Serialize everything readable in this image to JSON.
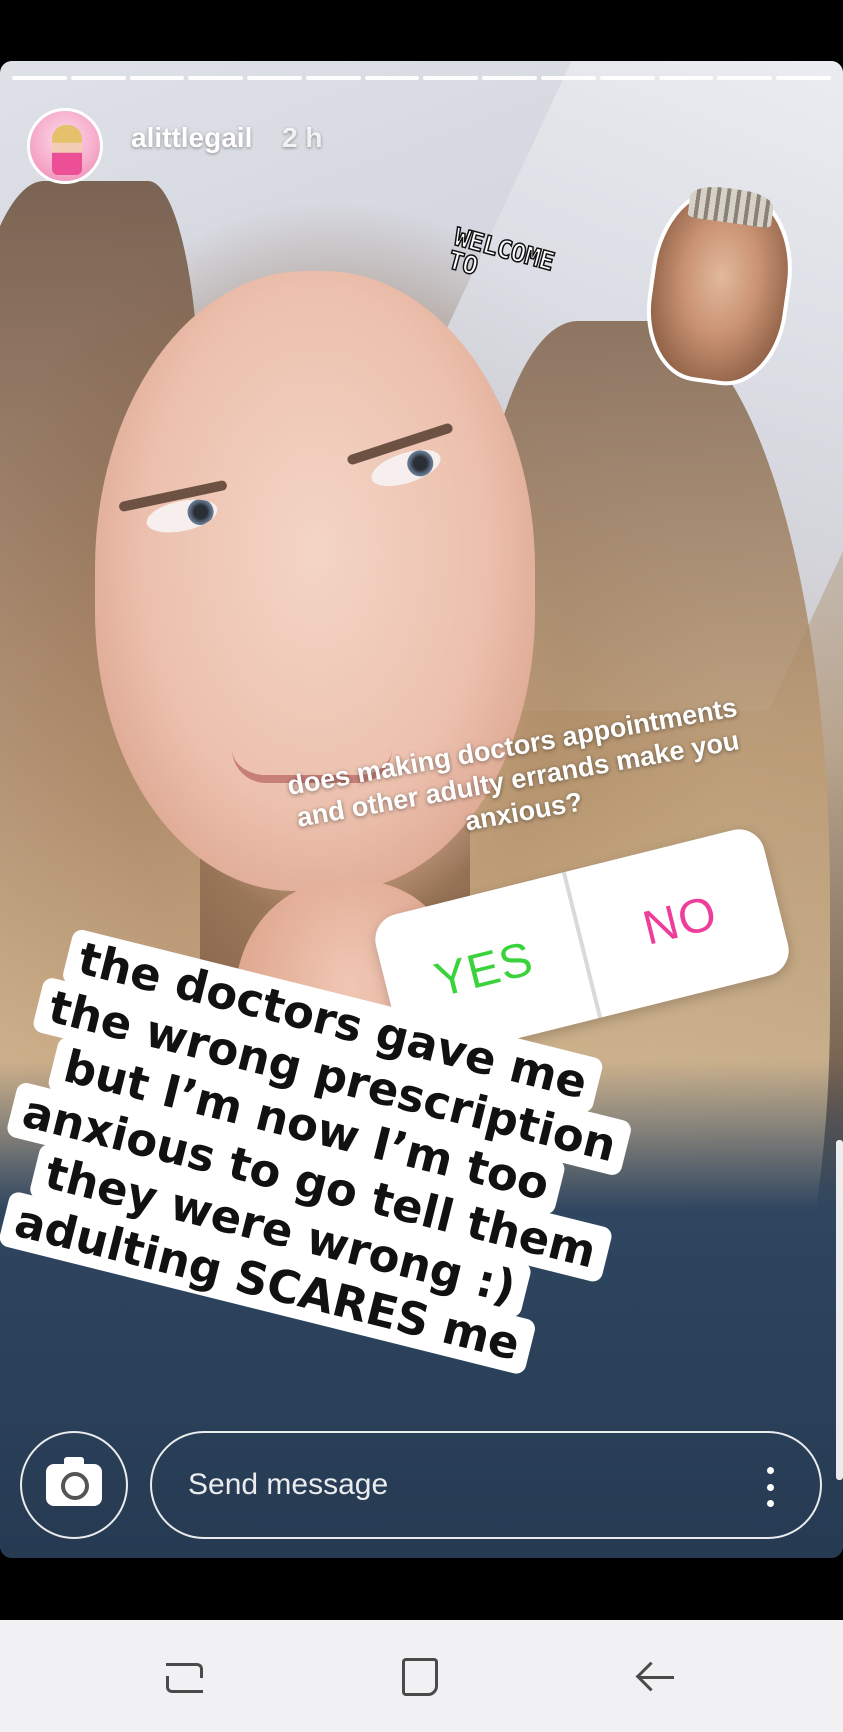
{
  "story": {
    "username": "alittlegail",
    "timestamp": "2 h",
    "progress": {
      "segments": 14,
      "current": 14
    }
  },
  "stickers": {
    "welcome_line1": "WELCOME",
    "welcome_line2": "TO"
  },
  "poll": {
    "question": "does making doctors appointments and other adulty errands make you anxious?",
    "yes_label": "YES",
    "no_label": "NO",
    "yes_color": "#3bd33b",
    "no_color": "#ee3d9b"
  },
  "caption": {
    "lines": [
      "the doctors gave me",
      "the wrong prescription",
      "but I’m now I’m too",
      "anxious to go tell them",
      "they were wrong :)",
      "adulting SCARES me"
    ]
  },
  "reply_bar": {
    "placeholder": "Send message",
    "camera_icon": "camera-icon",
    "more_icon": "more-vertical-icon"
  },
  "system_nav": {
    "recent_icon": "recent-apps-icon",
    "home_icon": "home-icon",
    "back_icon": "back-icon"
  }
}
